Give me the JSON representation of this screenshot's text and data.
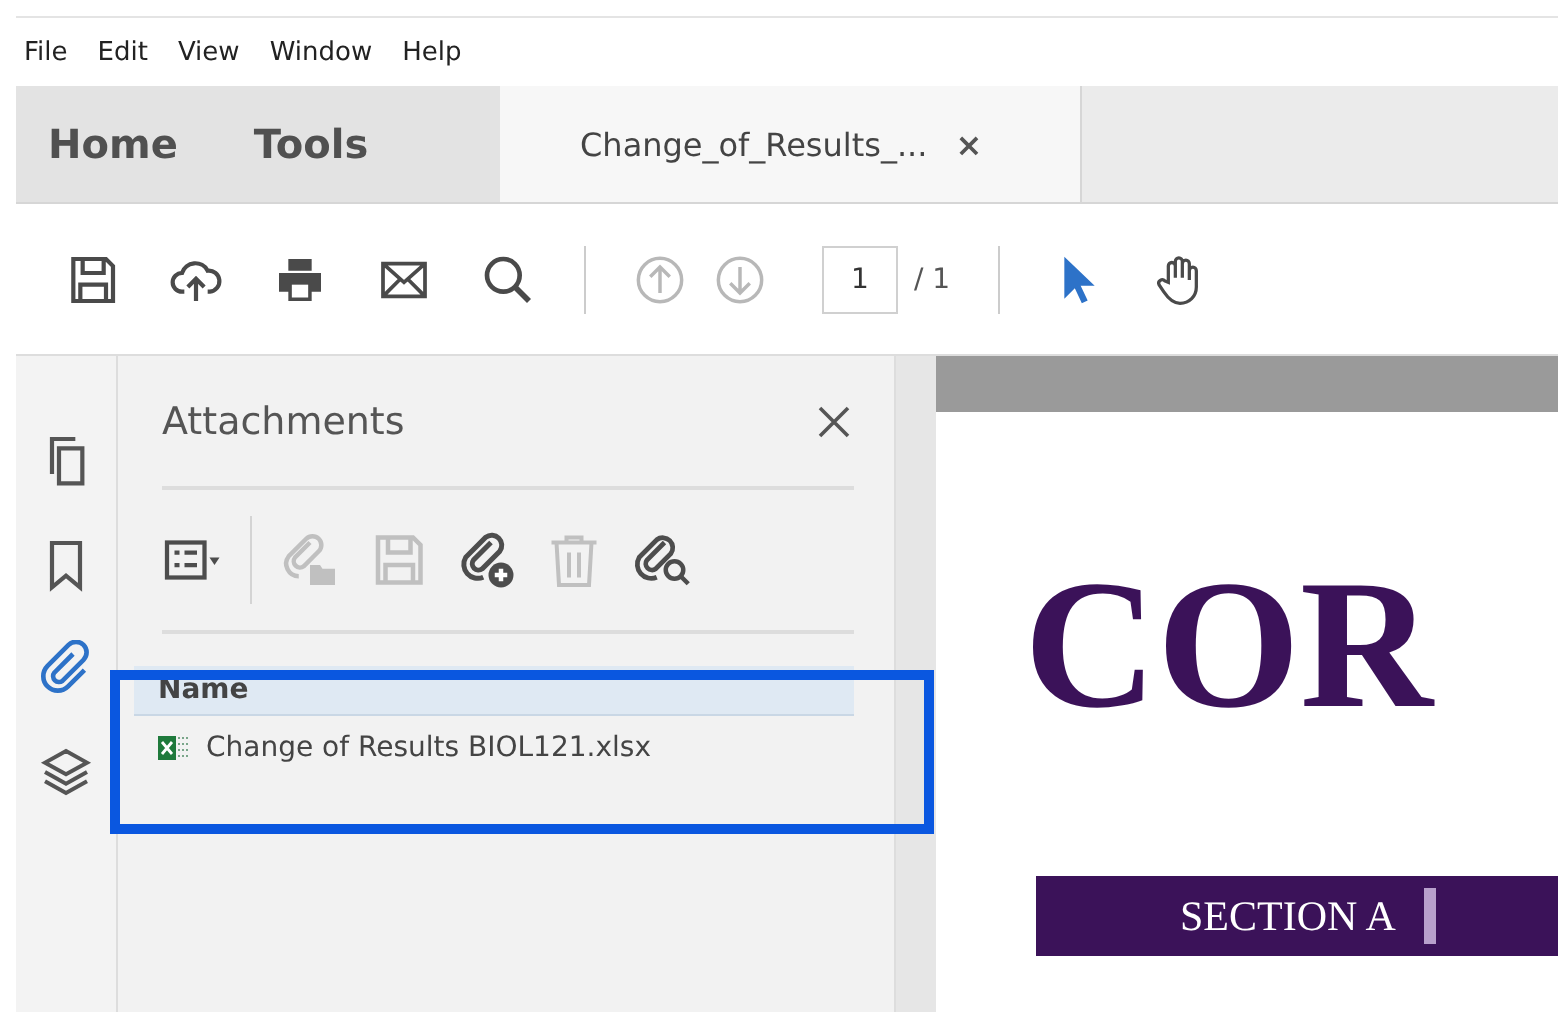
{
  "menu": [
    "File",
    "Edit",
    "View",
    "Window",
    "Help"
  ],
  "tabs": [
    {
      "label": "Home",
      "kind": "nav",
      "selected": false
    },
    {
      "label": "Tools",
      "kind": "nav",
      "selected": false
    },
    {
      "label": "Change_of_Results_...",
      "kind": "document",
      "selected": true,
      "close": "×"
    }
  ],
  "toolbar": {
    "tools": [
      {
        "kind": "save",
        "disabled": false
      },
      {
        "kind": "upload",
        "disabled": false
      },
      {
        "kind": "print",
        "disabled": false
      },
      {
        "kind": "mail",
        "disabled": false
      },
      {
        "kind": "search",
        "disabled": false
      }
    ],
    "nav": [
      {
        "kind": "up",
        "disabled": true
      },
      {
        "kind": "down",
        "disabled": true
      }
    ],
    "page": "1",
    "page_total": "/ 1",
    "modes": [
      {
        "kind": "pointer",
        "selected": true
      },
      {
        "kind": "hand",
        "selected": false
      }
    ]
  },
  "side_nav": [
    {
      "kind": "pages",
      "selected": false
    },
    {
      "kind": "bookmark",
      "selected": false
    },
    {
      "kind": "clip",
      "selected": true
    },
    {
      "kind": "layers",
      "selected": false
    }
  ],
  "panel": {
    "title": "Attachments",
    "tools": [
      {
        "kind": "options",
        "disabled": false
      },
      {
        "kind": "open",
        "disabled": true
      },
      {
        "kind": "save",
        "disabled": true
      },
      {
        "kind": "add",
        "disabled": false
      },
      {
        "kind": "delete",
        "disabled": true
      },
      {
        "kind": "find",
        "disabled": false
      }
    ],
    "column": "Name",
    "files": [
      {
        "name": "Change of Results BIOL121.xlsx",
        "highlighted": true
      }
    ]
  },
  "document": {
    "heading": "COR",
    "section": "SECTION A"
  }
}
